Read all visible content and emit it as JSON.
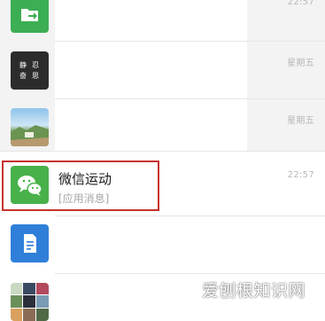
{
  "chats": [
    {
      "name": "",
      "time": "22:57",
      "avatar": "file-transfer-icon",
      "color": "#3cae53"
    },
    {
      "avatar_text": [
        "静",
        "忍",
        "奋",
        "思"
      ],
      "time": "星期五",
      "avatar": "text-logo-avatar",
      "color": "#2c2c2c"
    },
    {
      "time": "星期五",
      "avatar": "landscape-photo-avatar"
    },
    {
      "name": "微信运动",
      "preview": "[应用消息]",
      "time": "22:57",
      "avatar": "wechat-sport-icon",
      "color": "#48b14a"
    },
    {
      "avatar": "document-icon",
      "color": "#2f7fd9"
    },
    {
      "avatar": "photo-grid-avatar"
    }
  ],
  "watermark": "爱刨根知识网",
  "colors": {
    "highlight": "#c8312c",
    "list_gray": "#f3f3f3"
  }
}
